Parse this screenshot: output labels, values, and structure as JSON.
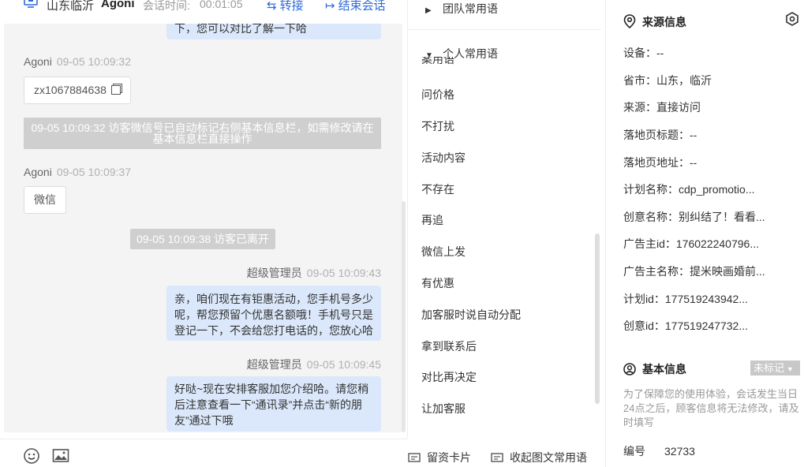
{
  "chat": {
    "header": {
      "location": "山东临沂",
      "visitor_name": "Agoni",
      "timer_label": "会话时间:",
      "timer_value": "00:01:05",
      "transfer_label": "转接",
      "end_label": "结束会话"
    },
    "messages": {
      "m0_text": "下，您可以对比了解一下哈",
      "m1_sender": "Agoni",
      "m1_time": "09-05 10:09:32",
      "m1_text": "zx1067884638",
      "sys1_line1": "09-05 10:09:32 访客微信号已自动标记右侧基本信息栏，如需修改请在",
      "sys1_line2": "基本信息栏直接操作",
      "m2_sender": "Agoni",
      "m2_time": "09-05 10:09:37",
      "m2_text": "微信",
      "sys2": "09-05 10:09:38 访客已离开",
      "m3_sender": "超级管理员",
      "m3_time": "09-05 10:09:43",
      "m3_line1": "亲，咱们现在有钜惠活动，您手机号多少",
      "m3_line2": "呢，帮您预留个优惠名额哦！手机号只是",
      "m3_line3": "登记一下，不会给您打电话的，您放心哈",
      "m4_sender": "超级管理员",
      "m4_time": "09-05 10:09:45",
      "m4_line1": "好哒~现在安排客服加您介绍哈。请您稍",
      "m4_line2": "后注意查看一下“通讯录”并点击“新的朋",
      "m4_line3": "友”通过下哦"
    },
    "footer": {
      "emoji_icon": "emoji-icon",
      "image_icon": "image-icon",
      "card_label": "留资卡片",
      "collapse_label": "收起图文常用语"
    }
  },
  "phrases": {
    "team_group": "团队常用语",
    "personal_group": "个人常用语",
    "partial_item": "案用语",
    "items": [
      "问价格",
      "不打扰",
      "活动内容",
      "不存在",
      "再追",
      "微信上发",
      "有优惠",
      "加客服时说自动分配",
      "拿到联系后",
      "对比再决定",
      "让加客服"
    ]
  },
  "info": {
    "source_title": "来源信息",
    "device": "设备：--",
    "province": "省市：山东，临沂",
    "source": "来源：直接访问",
    "landing_title": "落地页标题：--",
    "landing_url": "落地页地址：--",
    "plan_name": "计划名称：cdp_promotio...",
    "creative_name": "创意名称：别纠结了！看看...",
    "advertiser_id": "广告主id：176022240796...",
    "advertiser_name": "广告主名称：提米映画婚前...",
    "plan_id": "计划id：177519243942...",
    "creative_id": "创意id：177519247732...",
    "basic_title": "基本信息",
    "tag_label": "未标记",
    "notice": "为了保障您的使用体验，会话发生当日24点之后，顾客信息将无法修改，请及时填写",
    "id_label": "编号",
    "id_value": "32733"
  },
  "colors": {
    "accent": "#2f6bd8",
    "bubble_out": "#dbe8fb",
    "system": "#cfcfcf",
    "chat_bg": "#f4f4f5"
  }
}
